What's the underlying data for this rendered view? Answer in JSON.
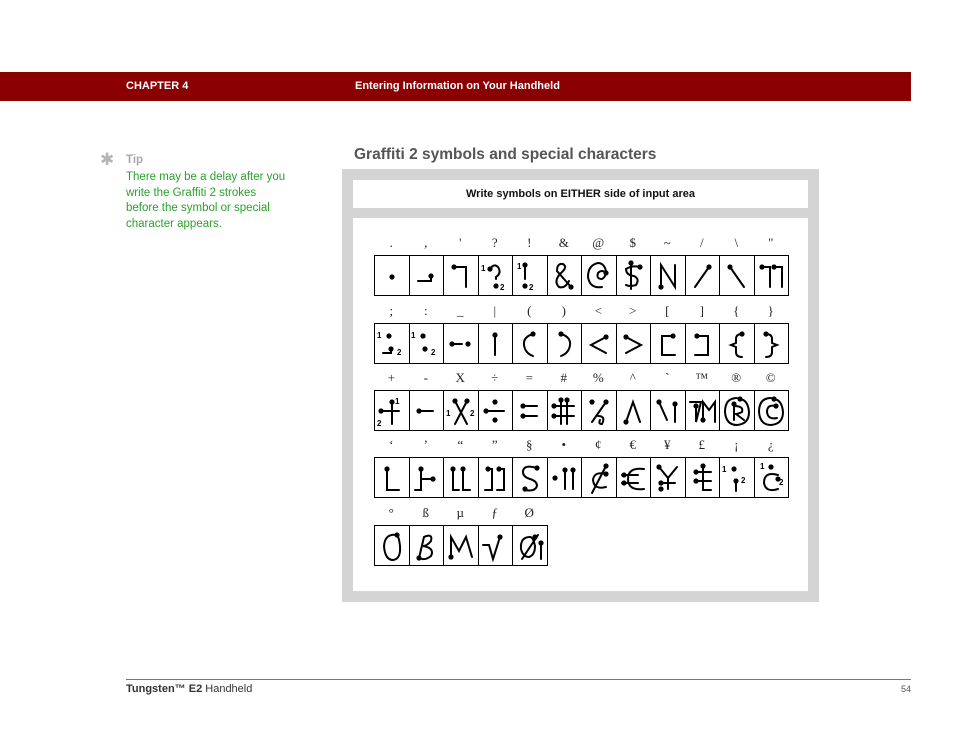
{
  "header": {
    "chapter": "CHAPTER 4",
    "title": "Entering Information on Your Handheld"
  },
  "tip": {
    "icon": "asterisk-icon",
    "label": "Tip",
    "text": "There may be a delay after you write the Graffiti 2 strokes before the symbol or special character appears."
  },
  "section": {
    "title": "Graffiti 2 symbols and special characters",
    "instruction": "Write symbols on EITHER side of input area"
  },
  "symbol_rows": [
    {
      "symbols": [
        ".",
        ",",
        "'",
        "?",
        "!",
        "&",
        "@",
        "$",
        "~",
        "/",
        "\\",
        "\""
      ]
    },
    {
      "symbols": [
        ";",
        ":",
        "_",
        "|",
        "(",
        ")",
        "<",
        ">",
        "[",
        "]",
        "{",
        "}"
      ]
    },
    {
      "symbols": [
        "+",
        "-",
        "X",
        "÷",
        "=",
        "#",
        "%",
        "^",
        "`",
        "™",
        "®",
        "©"
      ]
    },
    {
      "symbols": [
        "‘",
        "’",
        "“",
        "”",
        "§",
        "•",
        "¢",
        "€",
        "¥",
        "£",
        "¡",
        "¿"
      ]
    },
    {
      "symbols": [
        "°",
        "ß",
        "µ",
        "ƒ",
        "Ø"
      ]
    }
  ],
  "footer": {
    "product_bold": "Tungsten™ E2",
    "product_rest": " Handheld",
    "page": "54"
  }
}
